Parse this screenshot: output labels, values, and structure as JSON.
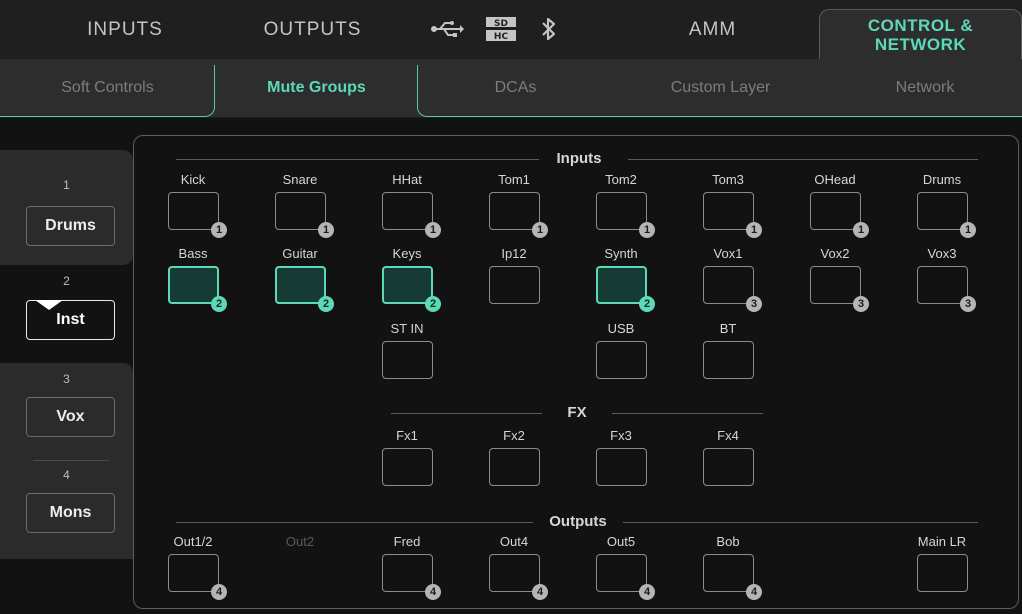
{
  "top_tabs": {
    "inputs": "INPUTS",
    "outputs": "OUTPUTS",
    "usb_icon": "usb-icon",
    "sdhc_icon": "sdhc-icon",
    "bluetooth_icon": "bluetooth-icon",
    "amm": "AMM",
    "control_network": "CONTROL & NETWORK"
  },
  "sub_tabs": [
    "Soft Controls",
    "Mute Groups",
    "DCAs",
    "Custom Layer",
    "Network"
  ],
  "groups": [
    {
      "num": "1",
      "label": "Drums"
    },
    {
      "num": "2",
      "label": "Inst"
    },
    {
      "num": "3",
      "label": "Vox"
    },
    {
      "num": "4",
      "label": "Mons"
    }
  ],
  "sections": {
    "inputs": "Inputs",
    "fx": "FX",
    "outputs": "Outputs"
  },
  "inputs_row1": [
    {
      "label": "Kick",
      "badge": "1",
      "on": false
    },
    {
      "label": "Snare",
      "badge": "1",
      "on": false
    },
    {
      "label": "HHat",
      "badge": "1",
      "on": false
    },
    {
      "label": "Tom1",
      "badge": "1",
      "on": false
    },
    {
      "label": "Tom2",
      "badge": "1",
      "on": false
    },
    {
      "label": "Tom3",
      "badge": "1",
      "on": false
    },
    {
      "label": "OHead",
      "badge": "1",
      "on": false
    },
    {
      "label": "Drums",
      "badge": "1",
      "on": false
    }
  ],
  "inputs_row2": [
    {
      "label": "Bass",
      "badge": "2",
      "on": true
    },
    {
      "label": "Guitar",
      "badge": "2",
      "on": true
    },
    {
      "label": "Keys",
      "badge": "2",
      "on": true
    },
    {
      "label": "Ip12",
      "badge": "",
      "on": false
    },
    {
      "label": "Synth",
      "badge": "2",
      "on": true
    },
    {
      "label": "Vox1",
      "badge": "3",
      "on": false
    },
    {
      "label": "Vox2",
      "badge": "3",
      "on": false
    },
    {
      "label": "Vox3",
      "badge": "3",
      "on": false
    }
  ],
  "inputs_row3": [
    {
      "label": "ST IN",
      "badge": "",
      "on": false
    },
    {
      "label": "USB",
      "badge": "",
      "on": false
    },
    {
      "label": "BT",
      "badge": "",
      "on": false
    }
  ],
  "fx": [
    {
      "label": "Fx1",
      "badge": "",
      "on": false
    },
    {
      "label": "Fx2",
      "badge": "",
      "on": false
    },
    {
      "label": "Fx3",
      "badge": "",
      "on": false
    },
    {
      "label": "Fx4",
      "badge": "",
      "on": false
    }
  ],
  "outputs": [
    {
      "label": "Out1/2",
      "badge": "4",
      "on": false,
      "dim": false,
      "box": true
    },
    {
      "label": "Out2",
      "badge": "",
      "on": false,
      "dim": true,
      "box": false
    },
    {
      "label": "Fred",
      "badge": "4",
      "on": false,
      "dim": false,
      "box": true
    },
    {
      "label": "Out4",
      "badge": "4",
      "on": false,
      "dim": false,
      "box": true
    },
    {
      "label": "Out5",
      "badge": "4",
      "on": false,
      "dim": false,
      "box": true
    },
    {
      "label": "Bob",
      "badge": "4",
      "on": false,
      "dim": false,
      "box": true
    },
    {
      "label": "Main LR",
      "badge": "",
      "on": false,
      "dim": false,
      "box": true
    }
  ],
  "colors": {
    "accent": "#5ed9b8",
    "active_fill": "#163b34",
    "badge_grey": "#b5b5b5"
  }
}
